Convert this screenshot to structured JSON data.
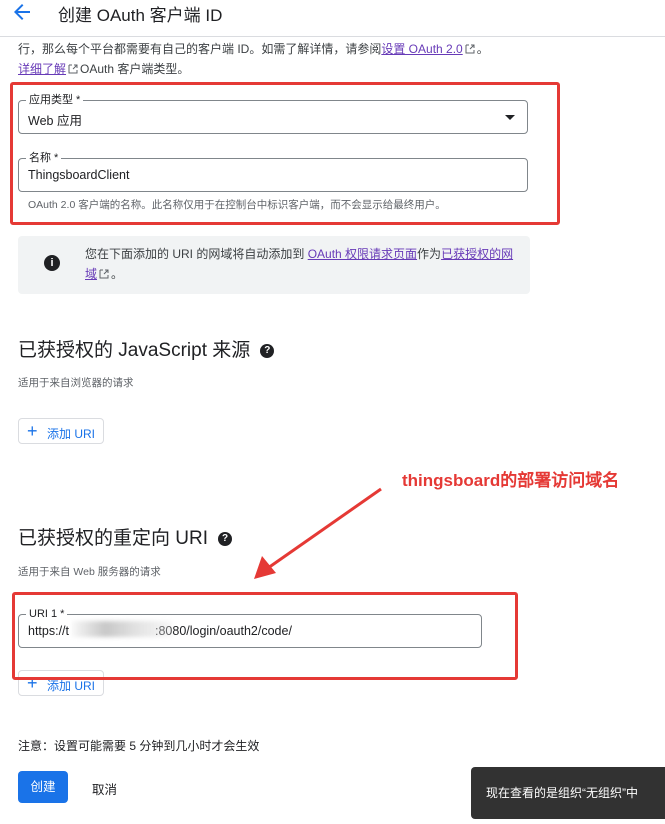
{
  "header": {
    "title": "创建 OAuth 客户端 ID"
  },
  "intro": {
    "line1_prefix": "行，那么每个平台都需要有自己的客户端 ID。如需了解详情，请参阅",
    "link_setup": "设置 OAuth 2.0",
    "line1_suffix": "。",
    "link_more": "详细了解",
    "line2_suffix": "OAuth 客户端类型。"
  },
  "form": {
    "app_type": {
      "label": "应用类型 *",
      "value": "Web 应用"
    },
    "name": {
      "label": "名称 *",
      "value": "ThingsboardClient",
      "hint": "OAuth 2.0 客户端的名称。此名称仅用于在控制台中标识客户端，而不会显示给最终用户。"
    }
  },
  "info_box": {
    "text_prefix": "您在下面添加的 URI 的网域将自动添加到",
    "link1": "OAuth 权限请求页面",
    "text_middle": "作为",
    "link2": "已获授权的网域",
    "text_suffix": "。"
  },
  "js_origins": {
    "title": "已获授权的 JavaScript 来源",
    "subtitle": "适用于来自浏览器的请求",
    "add_label": "添加 URI"
  },
  "redirect_uris": {
    "title": "已获授权的重定向 URI",
    "subtitle": "适用于来自 Web 服务器的请求",
    "uri1_label": "URI 1 *",
    "uri1_prefix": "https://t",
    "uri1_suffix": ":8080/login/oauth2/code/",
    "add_label": "添加 URI"
  },
  "annotation": {
    "text": "thingsboard的部署访问域名",
    "color": "#e53935"
  },
  "footer": {
    "note": "注意：设置可能需要 5 分钟到几小时才会生效",
    "create_label": "创建",
    "cancel_label": "取消"
  },
  "toast": {
    "text": "现在查看的是组织“无组织”中"
  },
  "colors": {
    "primary": "#1a73e8",
    "link": "#673ab7",
    "annotation_red": "#e53935"
  }
}
